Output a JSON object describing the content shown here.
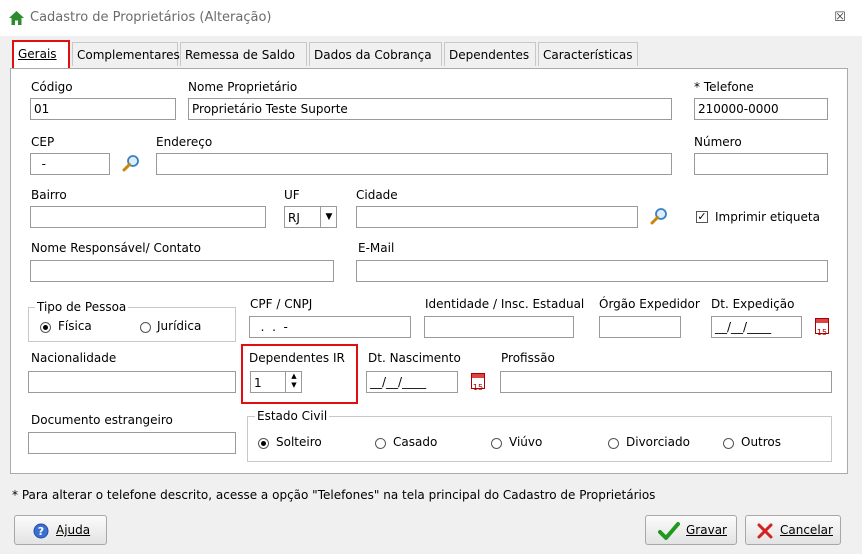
{
  "window": {
    "title": "Cadastro de Proprietários (Alteração)",
    "close": "☒"
  },
  "tabs": [
    "Gerais",
    "Complementares",
    "Remessa de Saldo",
    "Dados da Cobrança",
    "Dependentes",
    "Características"
  ],
  "fields": {
    "codigo": {
      "label": "Código",
      "value": "01"
    },
    "nome": {
      "label": "Nome Proprietário",
      "value": "Proprietário Teste Suporte"
    },
    "telefone": {
      "label": "* Telefone",
      "value": "210000-0000"
    },
    "cep": {
      "label": "CEP",
      "value": "  -"
    },
    "endereco": {
      "label": "Endereço",
      "value": ""
    },
    "numero": {
      "label": "Número",
      "value": ""
    },
    "bairro": {
      "label": "Bairro",
      "value": ""
    },
    "uf": {
      "label": "UF",
      "value": "RJ"
    },
    "cidade": {
      "label": "Cidade",
      "value": ""
    },
    "imprimir": {
      "label": "Imprimir etiqueta",
      "checked": true
    },
    "responsavel": {
      "label": "Nome Responsável/ Contato",
      "value": ""
    },
    "email": {
      "label": "E-Mail",
      "value": ""
    },
    "cpf": {
      "label": "CPF / CNPJ",
      "value": "  .  .  -"
    },
    "identidade": {
      "label": "Identidade / Insc. Estadual",
      "value": ""
    },
    "orgao": {
      "label": "Órgão Expedidor",
      "value": ""
    },
    "dt_expedicao": {
      "label": "Dt. Expedição",
      "value": "__/__/____"
    },
    "nacionalidade": {
      "label": "Nacionalidade",
      "value": ""
    },
    "dependentes_ir": {
      "label": "Dependentes IR",
      "value": "1"
    },
    "dt_nascimento": {
      "label": "Dt. Nascimento",
      "value": "__/__/____"
    },
    "profissao": {
      "label": "Profissão",
      "value": ""
    },
    "doc_estrangeiro": {
      "label": "Documento estrangeiro",
      "value": ""
    }
  },
  "tipo_pessoa": {
    "title": "Tipo de Pessoa",
    "options": [
      "Física",
      "Jurídica"
    ],
    "selected": "Física"
  },
  "estado_civil": {
    "title": "Estado Civil",
    "options": [
      "Solteiro",
      "Casado",
      "Viúvo",
      "Divorciado",
      "Outros"
    ],
    "selected": "Solteiro"
  },
  "note": "* Para alterar o telefone descrito, acesse a opção \"Telefones\" na tela principal do Cadastro de Proprietários",
  "buttons": {
    "help": "Ajuda",
    "save": "Gravar",
    "cancel": "Cancelar"
  },
  "colors": {
    "highlight": "#e01010"
  }
}
